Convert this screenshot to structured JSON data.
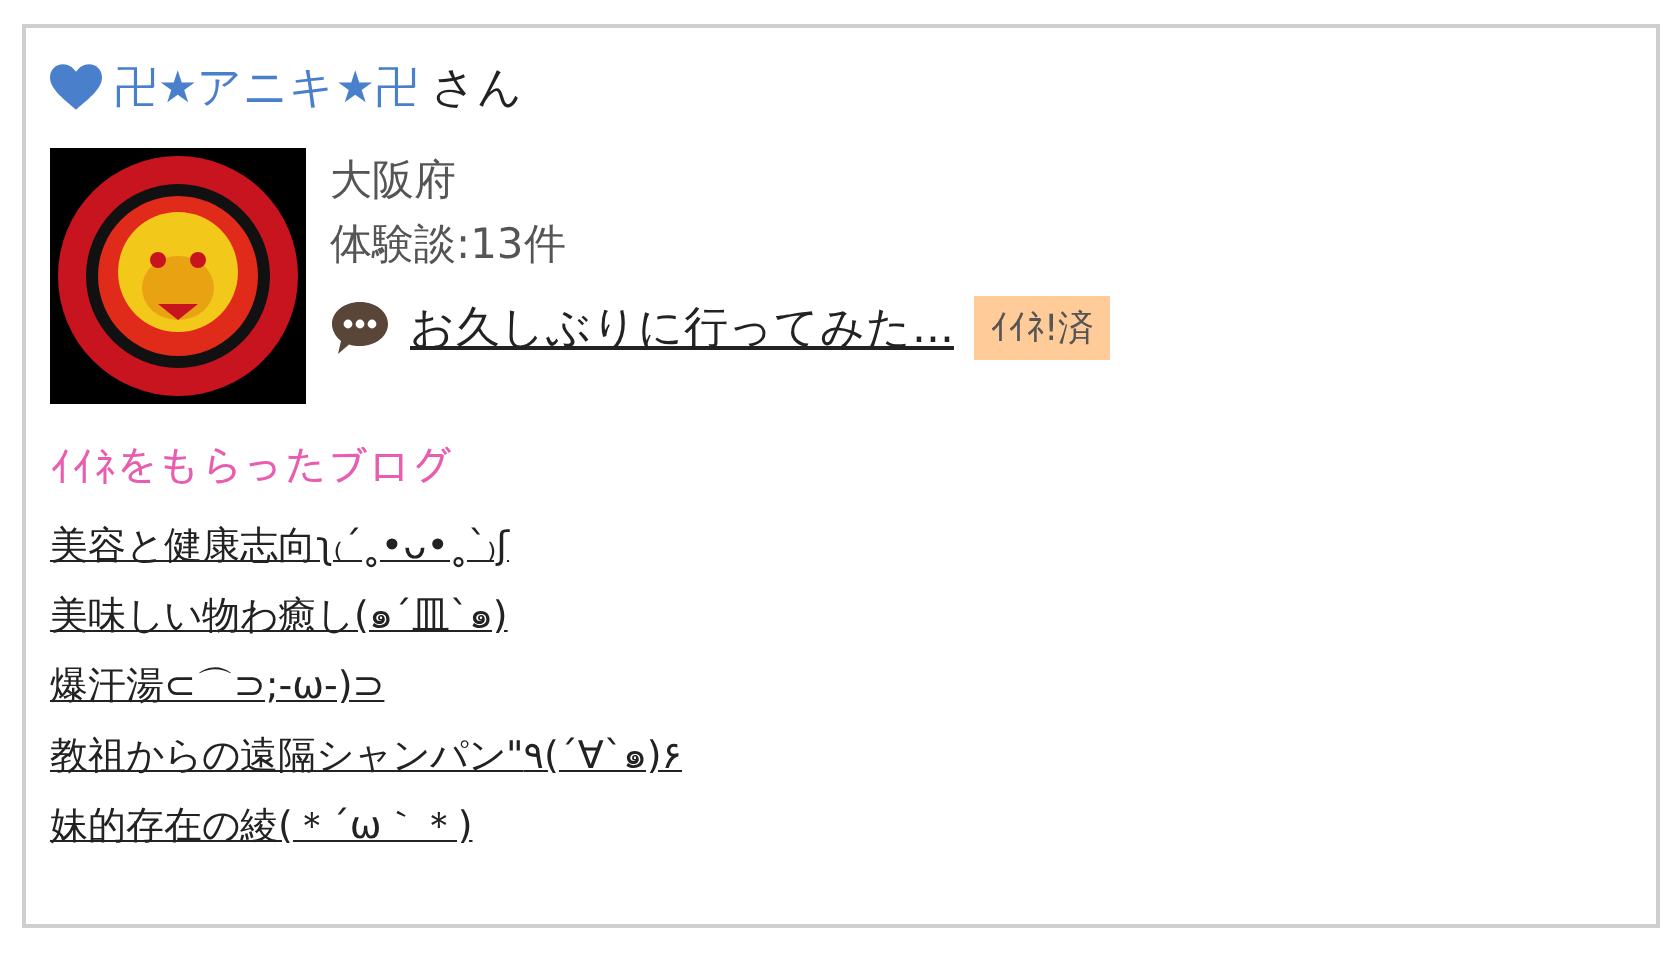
{
  "user": {
    "name": "卍★アニキ★卍",
    "suffix": "さん"
  },
  "prefecture": "大阪府",
  "reviews": "体験談:13件",
  "latest_post": {
    "title": "お久しぶりに行ってみた...",
    "badge": "ｲｲﾈ!済"
  },
  "section_title": "ｲｲﾈをもらったブログ",
  "blogs": [
    "美容と健康志向ʅ₍´˳•ᴗ•˳`₎ʃ",
    "美味しい物わ癒し(๑´皿`๑)",
    "爆汗湯⊂⌒⊃;-ω-)⊃",
    "教祖からの遠隔シャンパン\"٩(´∀`๑)۶",
    "妹的存在の綾(＊´ω｀＊)"
  ]
}
